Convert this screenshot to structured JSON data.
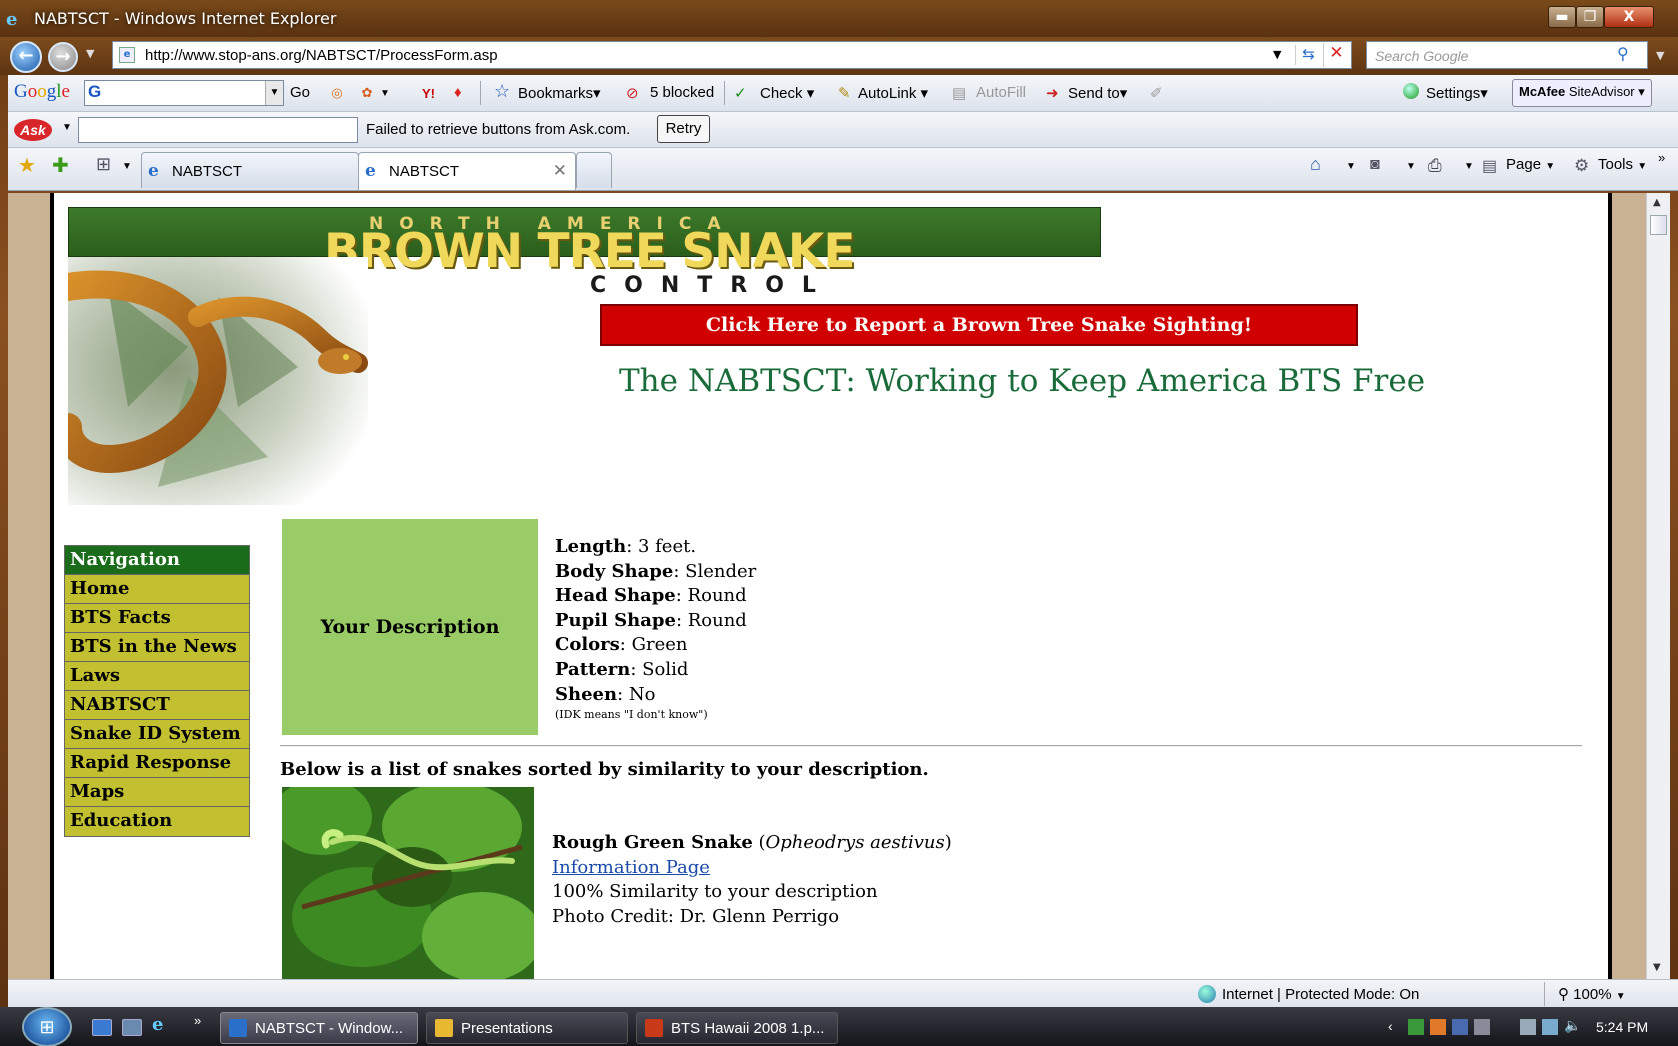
{
  "window": {
    "title": "NABTSCT - Windows Internet Explorer",
    "min_glyph": "▬",
    "max_glyph": "❐",
    "close_glyph": "X"
  },
  "address": {
    "url": "http://www.stop-ans.org/NABTSCT/ProcessForm.asp",
    "search_placeholder": "Search Google"
  },
  "google_toolbar": {
    "logo_letters": [
      "G",
      "o",
      "o",
      "g",
      "l",
      "e"
    ],
    "go_label": "Go",
    "bookmarks": "Bookmarks",
    "blocked": "5 blocked",
    "check": "Check",
    "autolink": "AutoLink",
    "autofill": "AutoFill",
    "send_to": "Send to",
    "settings": "Settings",
    "mcafee": "McAfee",
    "siteadvisor": "SiteAdvisor"
  },
  "ask_toolbar": {
    "logo": "Ask",
    "message": "Failed to retrieve buttons from Ask.com.",
    "retry": "Retry"
  },
  "tabs": [
    {
      "label": "NABTSCT"
    },
    {
      "label": "NABTSCT"
    }
  ],
  "command_bar": {
    "page": "Page",
    "tools": "Tools"
  },
  "page": {
    "banner_top": "NORTH AMERICA",
    "banner_main": "BROWN TREE SNAKE",
    "banner_sub": "CONTROL",
    "report_button": "Click Here to Report a Brown Tree Snake Sighting!",
    "tagline": "The NABTSCT: Working to Keep America BTS Free",
    "navigation": [
      "Navigation",
      "Home",
      "BTS Facts",
      "BTS in the News",
      "Laws",
      "NABTSCT",
      "Snake ID System",
      "Rapid Response",
      "Maps",
      "Education"
    ],
    "description_label": "Your Description",
    "description": [
      {
        "key": "Length",
        "value": ": 3 feet."
      },
      {
        "key": "Body Shape",
        "value": ": Slender"
      },
      {
        "key": "Head Shape",
        "value": ": Round"
      },
      {
        "key": "Pupil Shape",
        "value": ": Round"
      },
      {
        "key": "Colors",
        "value": ": Green"
      },
      {
        "key": "Pattern",
        "value": ": Solid"
      },
      {
        "key": "Sheen",
        "value": ": No"
      }
    ],
    "idk_note": "(IDK means \"I don't know\")",
    "list_intro": "Below is a list of snakes sorted by similarity to your description.",
    "result": {
      "common_name": "Rough Green Snake",
      "open_paren": " (",
      "scientific_name": "Opheodrys aestivus",
      "close_paren": ")",
      "link": "Information Page",
      "similarity": "100% Similarity to your description",
      "credit": "Photo Credit: Dr. Glenn Perrigo"
    }
  },
  "status": {
    "zone": "Internet | Protected Mode: On",
    "zoom": "100%"
  },
  "taskbar": {
    "tasks": [
      {
        "label": "NABTSCT - Window...",
        "color": "#2a6fc9"
      },
      {
        "label": "Presentations",
        "color": "#e8b830"
      },
      {
        "label": "BTS Hawaii 2008 1.p...",
        "color": "#c83a1a"
      }
    ],
    "clock": "5:24 PM"
  },
  "colors": {
    "banner_green": "#2b5e1c",
    "report_red": "#d10000",
    "tagline_green": "#1a6b3a",
    "nav_head": "#1a6b1a",
    "nav_item": "#c2c030",
    "desc_box": "#99cc66",
    "link_blue": "#1a4aa8"
  }
}
